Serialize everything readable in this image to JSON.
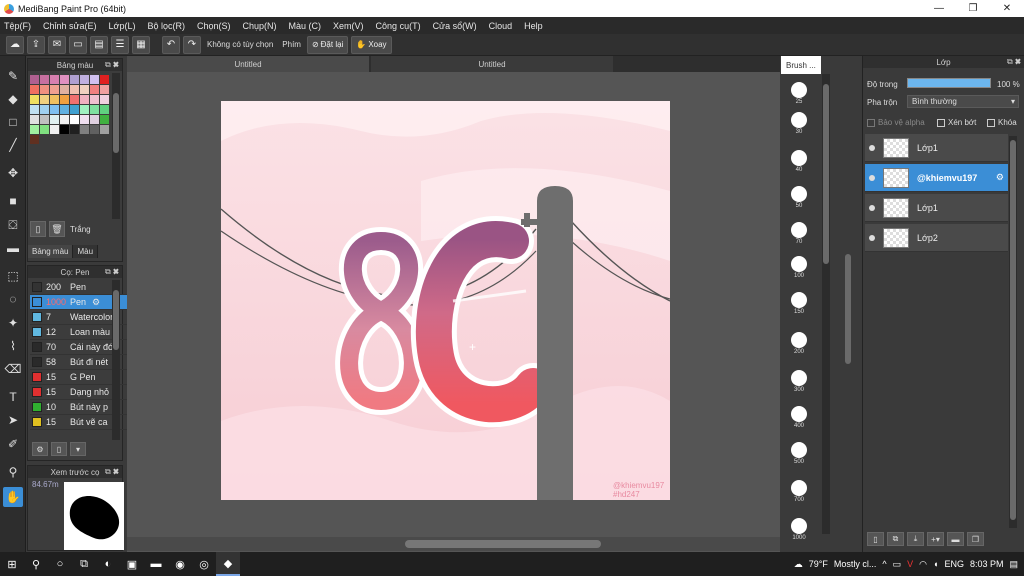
{
  "window": {
    "title": "MediBang Paint Pro (64bit)",
    "minimize": "—",
    "maximize": "❐",
    "close": "✕"
  },
  "menu": [
    "Tệp(F)",
    "Chỉnh sửa(E)",
    "Lớp(L)",
    "Bộ lọc(R)",
    "Chọn(S)",
    "Chụp(N)",
    "Màu (C)",
    "Xem(V)",
    "Công cụ(T)",
    "Cửa sổ(W)",
    "Cloud",
    "Help"
  ],
  "toolbar": {
    "no_option": "Không có tùy chọn",
    "shortcut_label": "Phím",
    "reset": "Đặt lại",
    "rotate": "Xoay"
  },
  "palette": {
    "title": "Bảng màu",
    "colors": [
      "#b06090",
      "#c870a0",
      "#d880b0",
      "#e090c0",
      "#b0a0d0",
      "#c0b0e0",
      "#d0c0f0",
      "#e02020",
      "#f07060",
      "#f09080",
      "#f0a090",
      "#e0b0a0",
      "#f0c0b0",
      "#f0d0c0",
      "#f08080",
      "#f0a0a0",
      "#f0e060",
      "#f0d080",
      "#f0c060",
      "#f0a040",
      "#f07070",
      "#f0b0c0",
      "#f0c0d0",
      "#f0d0e0",
      "#c0e0f0",
      "#a0d0f0",
      "#80c0f0",
      "#60b0e0",
      "#40a0d0",
      "#a0f0c0",
      "#80e0a0",
      "#60d080",
      "#e0e0e0",
      "#c0c0c0",
      "#e0f0f0",
      "#f0f0f0",
      "#ffffff",
      "#f0e0f0",
      "#e0d0e0",
      "#40b040",
      "#a0f0a0",
      "#80e080",
      "#f0f0f0",
      "#000000",
      "#202020",
      "#808080",
      "#606060",
      "#a0a0a0",
      "#603020"
    ],
    "footer_label": "Trắng",
    "tabs": [
      "Bảng màu",
      "Màu"
    ]
  },
  "brush": {
    "title": "Cọ: Pen",
    "items": [
      {
        "size": "200",
        "name": "Pen",
        "color": "#333333"
      },
      {
        "size": "1000",
        "name": "Pen",
        "color": "#3b8ed6",
        "selected": true
      },
      {
        "size": "7",
        "name": "Watercolor",
        "color": "#60b8e0"
      },
      {
        "size": "12",
        "name": "Loan màu",
        "color": "#60b8e0"
      },
      {
        "size": "70",
        "name": "Cái này đó",
        "color": "#2a2a2a"
      },
      {
        "size": "58",
        "name": "Bút đi nét",
        "color": "#2a2a2a"
      },
      {
        "size": "15",
        "name": "G Pen",
        "color": "#e03030"
      },
      {
        "size": "15",
        "name": "Dạng nhỏ",
        "color": "#e03030"
      },
      {
        "size": "10",
        "name": "Bút này p",
        "color": "#30b030"
      },
      {
        "size": "15",
        "name": "Bút vẽ ca",
        "color": "#e0c020"
      }
    ]
  },
  "preview": {
    "title": "Xem trước cọ",
    "zoom": "84.67m"
  },
  "canvas": {
    "tabs": [
      "Untitled",
      "Untitled"
    ],
    "watermark1": "@khiemvu197",
    "watermark2": "#hd247",
    "art_text": "8C"
  },
  "brush_sizes": {
    "title": "Brush ...",
    "values": [
      "25",
      "30",
      "40",
      "50",
      "70",
      "100",
      "150",
      "200",
      "300",
      "400",
      "500",
      "700",
      "1000"
    ]
  },
  "layers": {
    "title": "Lớp",
    "opacity_label": "Độ trong",
    "opacity_value": "100 %",
    "opacity_level": 1.0,
    "blend_label": "Pha trộn",
    "blend_value": "Bình thường",
    "protect_alpha": "Bảo vệ alpha",
    "clipping": "Xén bớt",
    "lock": "Khóa",
    "items": [
      {
        "name": "Lớp1",
        "selected": false
      },
      {
        "name": "@khiemvu197",
        "selected": true
      },
      {
        "name": "Lớp1",
        "selected": false
      },
      {
        "name": "Lớp2",
        "selected": false
      }
    ]
  },
  "taskbar": {
    "weather": "79°F",
    "weather_text": "Mostly cl...",
    "lang": "ENG",
    "time": "8:03 PM"
  }
}
